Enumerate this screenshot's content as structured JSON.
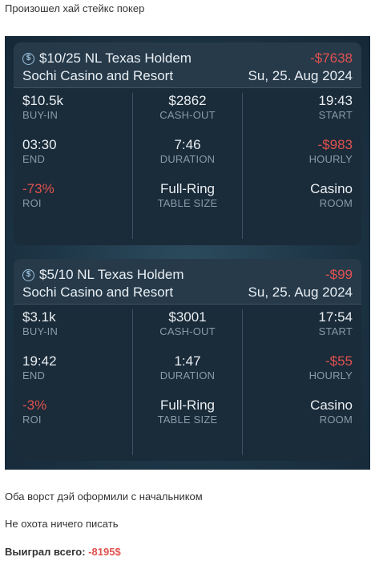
{
  "intro_text": "Произошел хай стейкс покер",
  "sessions": [
    {
      "game": "$10/25 NL Texas Holdem",
      "venue": "Sochi Casino and Resort",
      "result": "-$7638",
      "date": "Su, 25. Aug 2024",
      "stats": {
        "buyin": {
          "value": "$10.5k",
          "label": "BUY-IN"
        },
        "cashout": {
          "value": "$2862",
          "label": "CASH-OUT"
        },
        "start": {
          "value": "19:43",
          "label": "START"
        },
        "end": {
          "value": "03:30",
          "label": "END"
        },
        "duration": {
          "value": "7:46",
          "label": "DURATION"
        },
        "hourly": {
          "value": "-$983",
          "label": "HOURLY"
        },
        "roi": {
          "value": "-73%",
          "label": "ROI"
        },
        "table_size": {
          "value": "Full-Ring",
          "label": "TABLE SIZE"
        },
        "room": {
          "value": "Casino",
          "label": "ROOM"
        }
      }
    },
    {
      "game": "$5/10 NL Texas Holdem",
      "venue": "Sochi Casino and Resort",
      "result": "-$99",
      "date": "Su, 25. Aug 2024",
      "stats": {
        "buyin": {
          "value": "$3.1k",
          "label": "BUY-IN"
        },
        "cashout": {
          "value": "$3001",
          "label": "CASH-OUT"
        },
        "start": {
          "value": "17:54",
          "label": "START"
        },
        "end": {
          "value": "19:42",
          "label": "END"
        },
        "duration": {
          "value": "1:47",
          "label": "DURATION"
        },
        "hourly": {
          "value": "-$55",
          "label": "HOURLY"
        },
        "roi": {
          "value": "-3%",
          "label": "ROI"
        },
        "table_size": {
          "value": "Full-Ring",
          "label": "TABLE SIZE"
        },
        "room": {
          "value": "Casino",
          "label": "ROOM"
        }
      }
    }
  ],
  "coin_icon": "$",
  "colors": {
    "negative": "#e0524f",
    "card_bg": "#1a2b39",
    "card_header": "#263a4a",
    "label": "#8a9aa8"
  },
  "paragraph_1": "Оба ворст дэй оформили с начальником",
  "paragraph_2": "Не охота ничего писать",
  "total": {
    "label": "Выиграл всего: ",
    "amount": "-8195$"
  }
}
